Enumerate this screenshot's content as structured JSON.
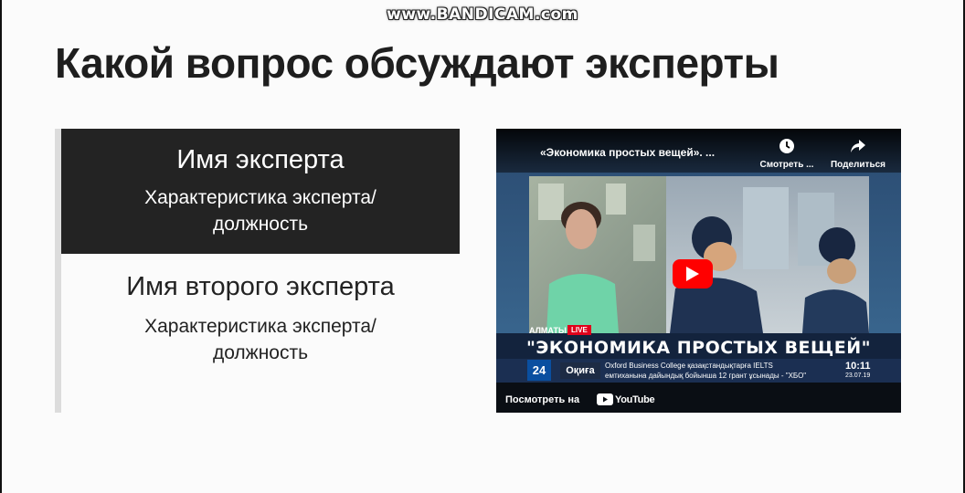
{
  "watermark": "www.BANDICAM.com",
  "slide": {
    "title": "Какой вопрос обсуждают эксперты"
  },
  "experts": [
    {
      "name": "Имя эксперта",
      "desc_line1": "Характеристика эксперта/",
      "desc_line2": "должность"
    },
    {
      "name": "Имя второго эксперта",
      "desc_line1": "Характеристика эксперта/",
      "desc_line2": "должность"
    }
  ],
  "video": {
    "title": "«Экономика простых вещей». ...",
    "watch_later_label": "Смотреть ...",
    "share_label": "Поделиться",
    "location": "АЛМАТЫ",
    "live": "LIVE",
    "show_title": "\"ЭКОНОМИКА ПРОСТЫХ ВЕЩЕЙ\"",
    "channel_logo": "24",
    "news_category": "Оқиға",
    "ticker_line1": "Oxford Business College қазақстандықтарға IELTS",
    "ticker_line2": "емтиханына дайындық бойынша 12 грант ұсынады - \"ХБО\"",
    "clock_time": "10:11",
    "clock_date": "23.07.19",
    "watch_on_label": "Посмотреть на",
    "youtube_text": "YouTube",
    "accent_color": "#ff0000"
  }
}
